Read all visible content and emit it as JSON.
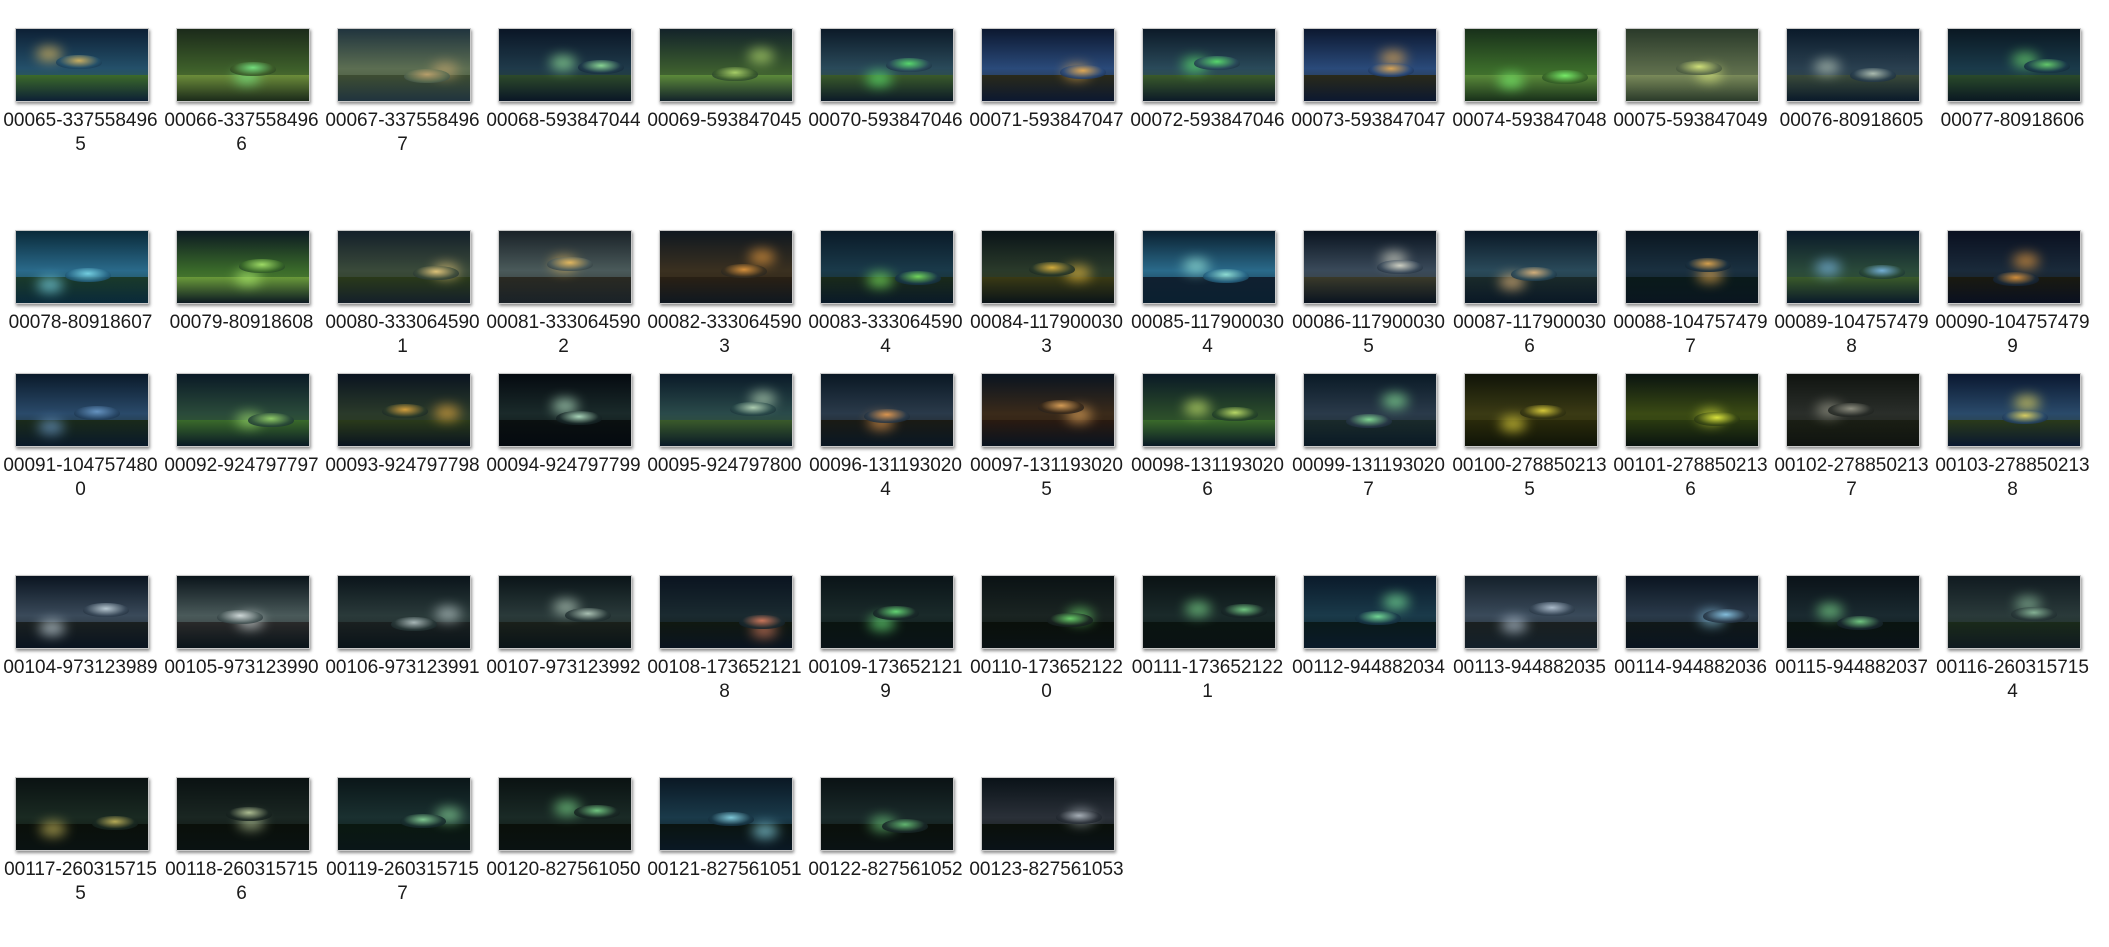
{
  "files": [
    {
      "name": "00065-3375584965",
      "palette": [
        "#0d2035",
        "#24506a",
        "#3c6a2a",
        "#e8c060"
      ]
    },
    {
      "name": "00066-3375584966",
      "palette": [
        "#1b2a1a",
        "#3d5e2a",
        "#6c8d3a",
        "#7cf08a"
      ]
    },
    {
      "name": "00067-3375584967",
      "palette": [
        "#20343e",
        "#5c6e52",
        "#3e4e32",
        "#c8a870"
      ]
    },
    {
      "name": "00068-593847044",
      "palette": [
        "#0a1626",
        "#1f3a4a",
        "#2d4a2a",
        "#9cf0a0"
      ]
    },
    {
      "name": "00069-593847045",
      "palette": [
        "#13232a",
        "#3a5a2e",
        "#5c8a3a",
        "#b8e070"
      ]
    },
    {
      "name": "00070-593847046",
      "palette": [
        "#0c1a28",
        "#2a4a5a",
        "#3a5a2a",
        "#60f070"
      ]
    },
    {
      "name": "00071-593847047",
      "palette": [
        "#0c1830",
        "#2a4a7a",
        "#2a2a1a",
        "#f0b050"
      ]
    },
    {
      "name": "00072-593847046",
      "palette": [
        "#0c1a28",
        "#2a4a5a",
        "#3a5a2a",
        "#60f070"
      ]
    },
    {
      "name": "00073-593847047",
      "palette": [
        "#0c1830",
        "#2a4a7a",
        "#2a2a1a",
        "#f0b050"
      ]
    },
    {
      "name": "00074-593847048",
      "palette": [
        "#18301a",
        "#3a6a2a",
        "#5a8a3a",
        "#7cfc70"
      ]
    },
    {
      "name": "00075-593847049",
      "palette": [
        "#2a3a2a",
        "#5a6a4a",
        "#7a8a5a",
        "#e0f080"
      ]
    },
    {
      "name": "00076-80918605",
      "palette": [
        "#0a1a2a",
        "#2a4050",
        "#3a4a3a",
        "#c0d0c0"
      ]
    },
    {
      "name": "00077-80918606",
      "palette": [
        "#0a1822",
        "#1a3a4a",
        "#2a4a2a",
        "#70e070"
      ]
    },
    {
      "name": "00078-80918607",
      "palette": [
        "#0a2a3a",
        "#2a6a8a",
        "#1a3a2a",
        "#80e0f0"
      ]
    },
    {
      "name": "00079-80918608",
      "palette": [
        "#0c1a22",
        "#3a6a2a",
        "#6a9a3a",
        "#b0f070"
      ]
    },
    {
      "name": "00080-3330645901",
      "palette": [
        "#14202a",
        "#3a4a3a",
        "#2a3a1a",
        "#f0d080"
      ]
    },
    {
      "name": "00081-3330645902",
      "palette": [
        "#1a2228",
        "#4a5a5a",
        "#2a2a22",
        "#f0c060"
      ]
    },
    {
      "name": "00082-3330645903",
      "palette": [
        "#101820",
        "#3a3020",
        "#2a2014",
        "#f0a040"
      ]
    },
    {
      "name": "00083-3330645904",
      "palette": [
        "#0a1a28",
        "#1a3a4a",
        "#1a2a1a",
        "#80f060"
      ]
    },
    {
      "name": "00084-1179000303",
      "palette": [
        "#0a1418",
        "#2a3a2a",
        "#3a3a14",
        "#f0c040"
      ]
    },
    {
      "name": "00085-1179000304",
      "palette": [
        "#0a2030",
        "#2a6a8a",
        "#102030",
        "#a0f0e0"
      ]
    },
    {
      "name": "00086-1179000305",
      "palette": [
        "#0a1420",
        "#3a4a5a",
        "#3a3a2a",
        "#e0e0d0"
      ]
    },
    {
      "name": "00087-1179000306",
      "palette": [
        "#0a1826",
        "#2a4a5a",
        "#1a2a2a",
        "#f0c080"
      ]
    },
    {
      "name": "00088-1047574797",
      "palette": [
        "#0a1620",
        "#1a3040",
        "#0a1a1a",
        "#f0b050"
      ]
    },
    {
      "name": "00089-1047574798",
      "palette": [
        "#0a1a2a",
        "#2a4a3a",
        "#3a5a2a",
        "#80c0f0"
      ]
    },
    {
      "name": "00090-1047574799",
      "palette": [
        "#0a1020",
        "#1a2a3a",
        "#1a1a10",
        "#f0a040"
      ]
    },
    {
      "name": "00091-1047574800",
      "palette": [
        "#0a1a2a",
        "#2a4a6a",
        "#1a2a1a",
        "#70a0d0"
      ]
    },
    {
      "name": "00092-924797797",
      "palette": [
        "#0a1a26",
        "#2a4a3a",
        "#3a6a2a",
        "#a0e070"
      ]
    },
    {
      "name": "00093-924797798",
      "palette": [
        "#0a1420",
        "#2a3a2a",
        "#2a3a1a",
        "#f0b040"
      ]
    },
    {
      "name": "00094-924797799",
      "palette": [
        "#050a10",
        "#1a2a2a",
        "#0a1010",
        "#c0f0d0"
      ]
    },
    {
      "name": "00095-924797800",
      "palette": [
        "#0a1a28",
        "#2a4a4a",
        "#3a5a2a",
        "#c0e0c0"
      ]
    },
    {
      "name": "00096-1311930204",
      "palette": [
        "#0a1824",
        "#2a3a4a",
        "#1a1a14",
        "#f0a050"
      ]
    },
    {
      "name": "00097-1311930205",
      "palette": [
        "#0a1420",
        "#3a2a1a",
        "#2a1a10",
        "#f0b060"
      ]
    },
    {
      "name": "00098-1311930206",
      "palette": [
        "#0a1a26",
        "#2a4a2a",
        "#3a6a2a",
        "#d0f070"
      ]
    },
    {
      "name": "00099-1311930207",
      "palette": [
        "#0a1a26",
        "#2a3a4a",
        "#1a2a2a",
        "#90f0a0"
      ]
    },
    {
      "name": "00100-2788502135",
      "palette": [
        "#101408",
        "#3a3a14",
        "#2a2a0a",
        "#f0e040"
      ]
    },
    {
      "name": "00101-2788502136",
      "palette": [
        "#0a1410",
        "#3a4a14",
        "#2a3a10",
        "#e8f040"
      ]
    },
    {
      "name": "00102-2788502137",
      "palette": [
        "#101410",
        "#2a2e2a",
        "#1a1e14",
        "#a0a090"
      ]
    },
    {
      "name": "00103-2788502138",
      "palette": [
        "#0a1830",
        "#2a4a6a",
        "#2a3a1a",
        "#f0e060"
      ]
    },
    {
      "name": "00104-973123989",
      "palette": [
        "#0a1420",
        "#3a4a5a",
        "#1a2020",
        "#d0e0e8"
      ]
    },
    {
      "name": "00105-973123990",
      "palette": [
        "#0a141a",
        "#4a5a5a",
        "#2a2a2a",
        "#e0e8e8"
      ]
    },
    {
      "name": "00106-973123991",
      "palette": [
        "#0a141a",
        "#2a3a3a",
        "#1a2020",
        "#c0d0d0"
      ]
    },
    {
      "name": "00107-973123992",
      "palette": [
        "#0a1418",
        "#2a3a3a",
        "#1a201a",
        "#c0d8c8"
      ]
    },
    {
      "name": "00108-1736521218",
      "palette": [
        "#0a1420",
        "#1a2a30",
        "#101810",
        "#e08060"
      ]
    },
    {
      "name": "00109-1736521219",
      "palette": [
        "#0a1418",
        "#1a2a2a",
        "#0a1410",
        "#70f080"
      ]
    },
    {
      "name": "00110-1736521220",
      "palette": [
        "#0a1214",
        "#1a2422",
        "#0a100a",
        "#70e070"
      ]
    },
    {
      "name": "00111-1736521221",
      "palette": [
        "#0a1214",
        "#1a2a2a",
        "#0a1410",
        "#80e090"
      ]
    },
    {
      "name": "00112-944882034",
      "palette": [
        "#0a1a2a",
        "#1a3a4a",
        "#0a1a1a",
        "#80f0a0"
      ]
    },
    {
      "name": "00113-944882035",
      "palette": [
        "#14202a",
        "#3a4a5a",
        "#1a2020",
        "#c0d0e0"
      ]
    },
    {
      "name": "00114-944882036",
      "palette": [
        "#0a1420",
        "#2a3a4a",
        "#101818",
        "#90d0f0"
      ]
    },
    {
      "name": "00115-944882037",
      "palette": [
        "#0a1218",
        "#1a2a30",
        "#0a1410",
        "#80e090"
      ]
    },
    {
      "name": "00116-2603157154",
      "palette": [
        "#101a20",
        "#2a3a3a",
        "#1a2a1a",
        "#90c0a0"
      ]
    },
    {
      "name": "00117-2603157155",
      "palette": [
        "#0a1212",
        "#1a2a22",
        "#0a100a",
        "#d0c060"
      ]
    },
    {
      "name": "00118-2603157156",
      "palette": [
        "#0a1212",
        "#1a2622",
        "#0a100a",
        "#c0d0a0"
      ]
    },
    {
      "name": "00119-2603157157",
      "palette": [
        "#0a1618",
        "#1a3030",
        "#0a1810",
        "#90e0a0"
      ]
    },
    {
      "name": "00120-827561050",
      "palette": [
        "#0a1212",
        "#1a2a26",
        "#0a100a",
        "#80e090"
      ]
    },
    {
      "name": "00121-827561051",
      "palette": [
        "#0a1824",
        "#1a3a4a",
        "#0a1410",
        "#90e0f0"
      ]
    },
    {
      "name": "00122-827561052",
      "palette": [
        "#0a1214",
        "#1a2a2a",
        "#0a100a",
        "#70d080"
      ]
    },
    {
      "name": "00123-827561053",
      "palette": [
        "#0a1218",
        "#2a3038",
        "#0a100a",
        "#b0b8c0"
      ]
    }
  ]
}
